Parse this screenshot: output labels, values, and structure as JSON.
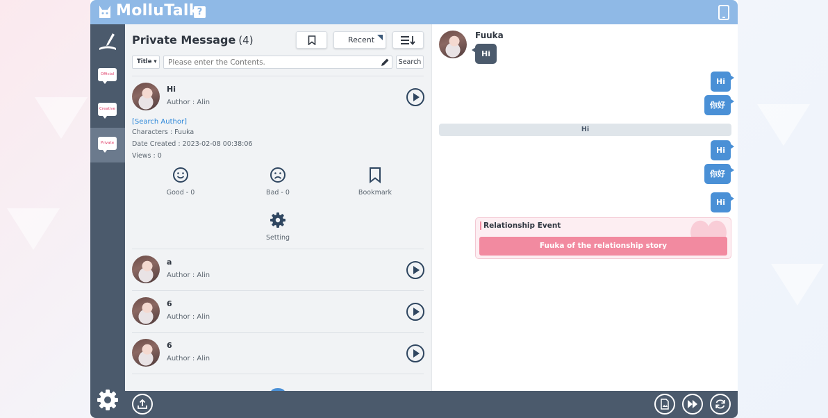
{
  "app": {
    "title": "MolluTalk",
    "help_label": "?"
  },
  "sidebar": {
    "items": [
      {
        "label": "Official"
      },
      {
        "label": "Creative"
      },
      {
        "label": "Private"
      }
    ]
  },
  "list": {
    "title": "Private Message",
    "count": "(4)",
    "sort_label": "Recent",
    "filter_label": "Title",
    "search_placeholder": "Please enter the Contents.",
    "search_button": "Search",
    "items": [
      {
        "title": "Hi",
        "author": "Author : Alin"
      },
      {
        "title": "a",
        "author": "Author : Alin"
      },
      {
        "title": "6",
        "author": "Author : Alin"
      },
      {
        "title": "6",
        "author": "Author : Alin"
      }
    ],
    "detail": {
      "search_author": "[Search Author]",
      "characters": "Characters : Fuuka",
      "date_created": "Date Created : 2023-02-08 00:38:06",
      "views": "Views : 0",
      "good": "Good - 0",
      "bad": "Bad - 0",
      "bookmark": "Bookmark",
      "setting": "Setting"
    }
  },
  "chat": {
    "character_name": "Fuuka",
    "messages": [
      {
        "side": "left",
        "text": "Hi"
      },
      {
        "side": "right",
        "text": "Hi"
      },
      {
        "side": "right",
        "text": "你好"
      },
      {
        "side": "narration",
        "text": "Hi"
      },
      {
        "side": "right",
        "text": "Hi"
      },
      {
        "side": "right",
        "text": "你好"
      },
      {
        "side": "right",
        "text": "Hi"
      }
    ],
    "relationship": {
      "title": "Relationship Event",
      "button": "Fuuka of the relationship story"
    }
  },
  "colors": {
    "header": "#8fb9e6",
    "sidebar": "#4b5a6c",
    "bubble_right": "#4a90d6",
    "relationship": "#f28aa0"
  }
}
